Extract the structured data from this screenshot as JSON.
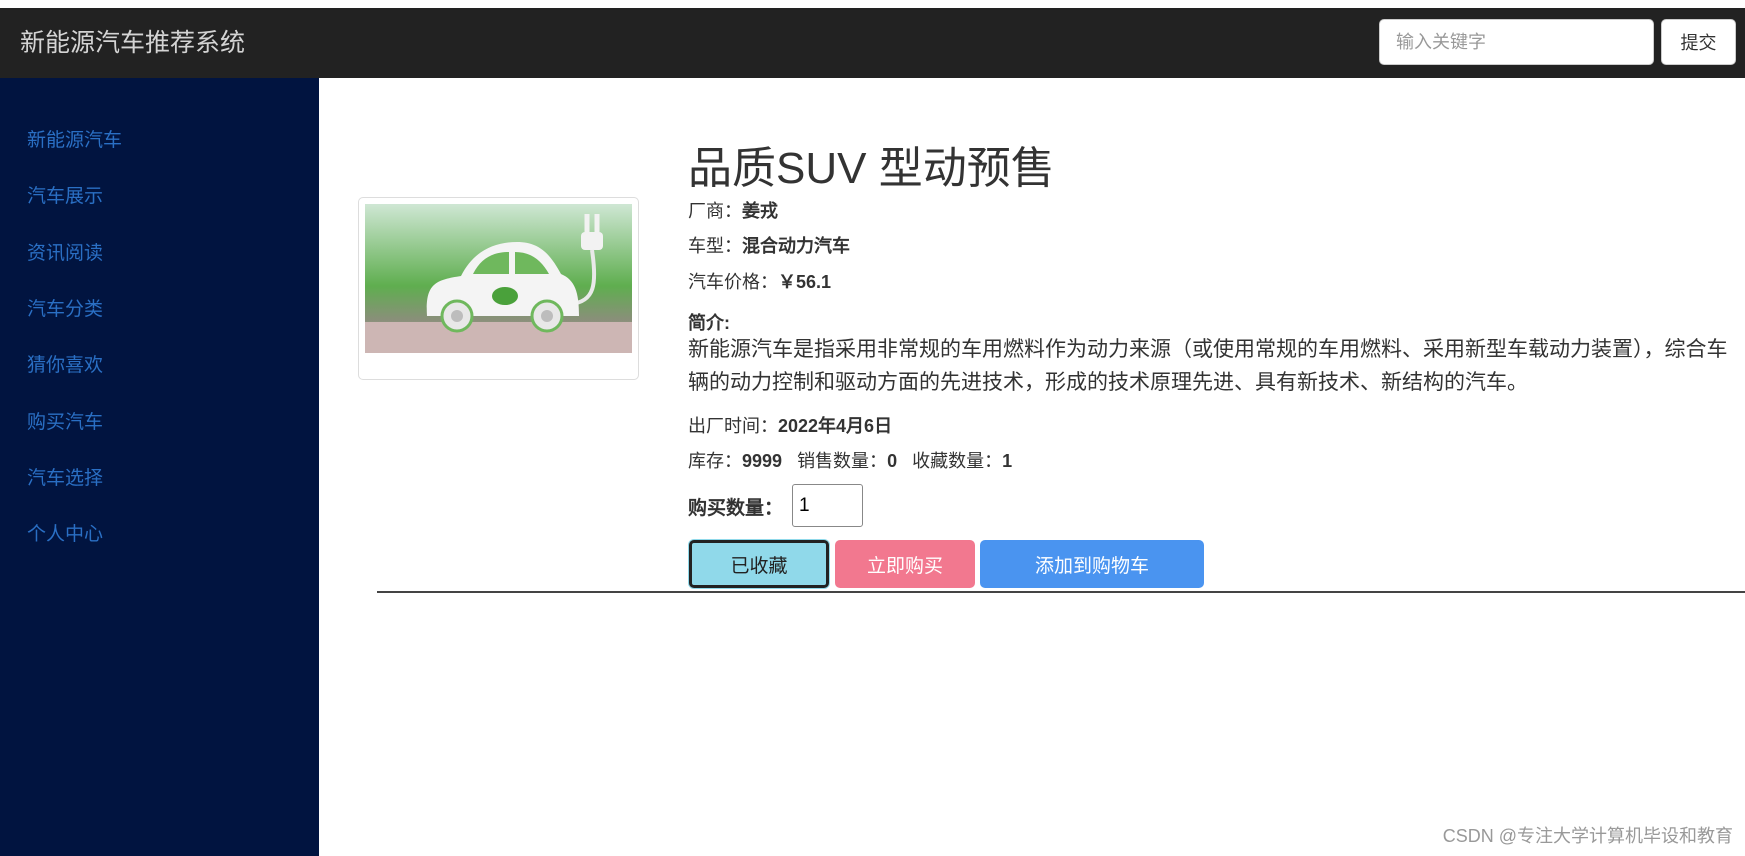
{
  "navbar": {
    "brand": "新能源汽车推荐系统",
    "search_placeholder": "输入关键字",
    "submit_label": "提交"
  },
  "sidebar": {
    "items": [
      {
        "label": "新能源汽车"
      },
      {
        "label": "汽车展示"
      },
      {
        "label": "资讯阅读"
      },
      {
        "label": "汽车分类"
      },
      {
        "label": "猜你喜欢"
      },
      {
        "label": "购买汽车"
      },
      {
        "label": "汽车选择"
      },
      {
        "label": "个人中心"
      }
    ]
  },
  "product": {
    "title": "品质SUV 型动预售",
    "vendor_label": "厂商：",
    "vendor": "姜戎",
    "type_label": "车型：",
    "type": "混合动力汽车",
    "price_label": "汽车价格：",
    "price": "￥56.1",
    "intro_label": "简介:",
    "intro": "新能源汽车是指采用非常规的车用燃料作为动力来源（或使用常规的车用燃料、采用新型车载动力装置），综合车辆的动力控制和驱动方面的先进技术，形成的技术原理先进、具有新技术、新结构的汽车。",
    "release_label": "出厂时间：",
    "release": "2022年4月6日",
    "stock_label": "库存：",
    "stock": "9999",
    "sold_label": "销售数量：",
    "sold": "0",
    "fav_label": "收藏数量：",
    "fav": "1",
    "qty_label": "购买数量：",
    "qty": "1"
  },
  "actions": {
    "favorited_label": "已收藏",
    "buy_label": "立即购买",
    "cart_label": "添加到购物车"
  },
  "watermark": "CSDN @专注大学计算机毕设和教育"
}
